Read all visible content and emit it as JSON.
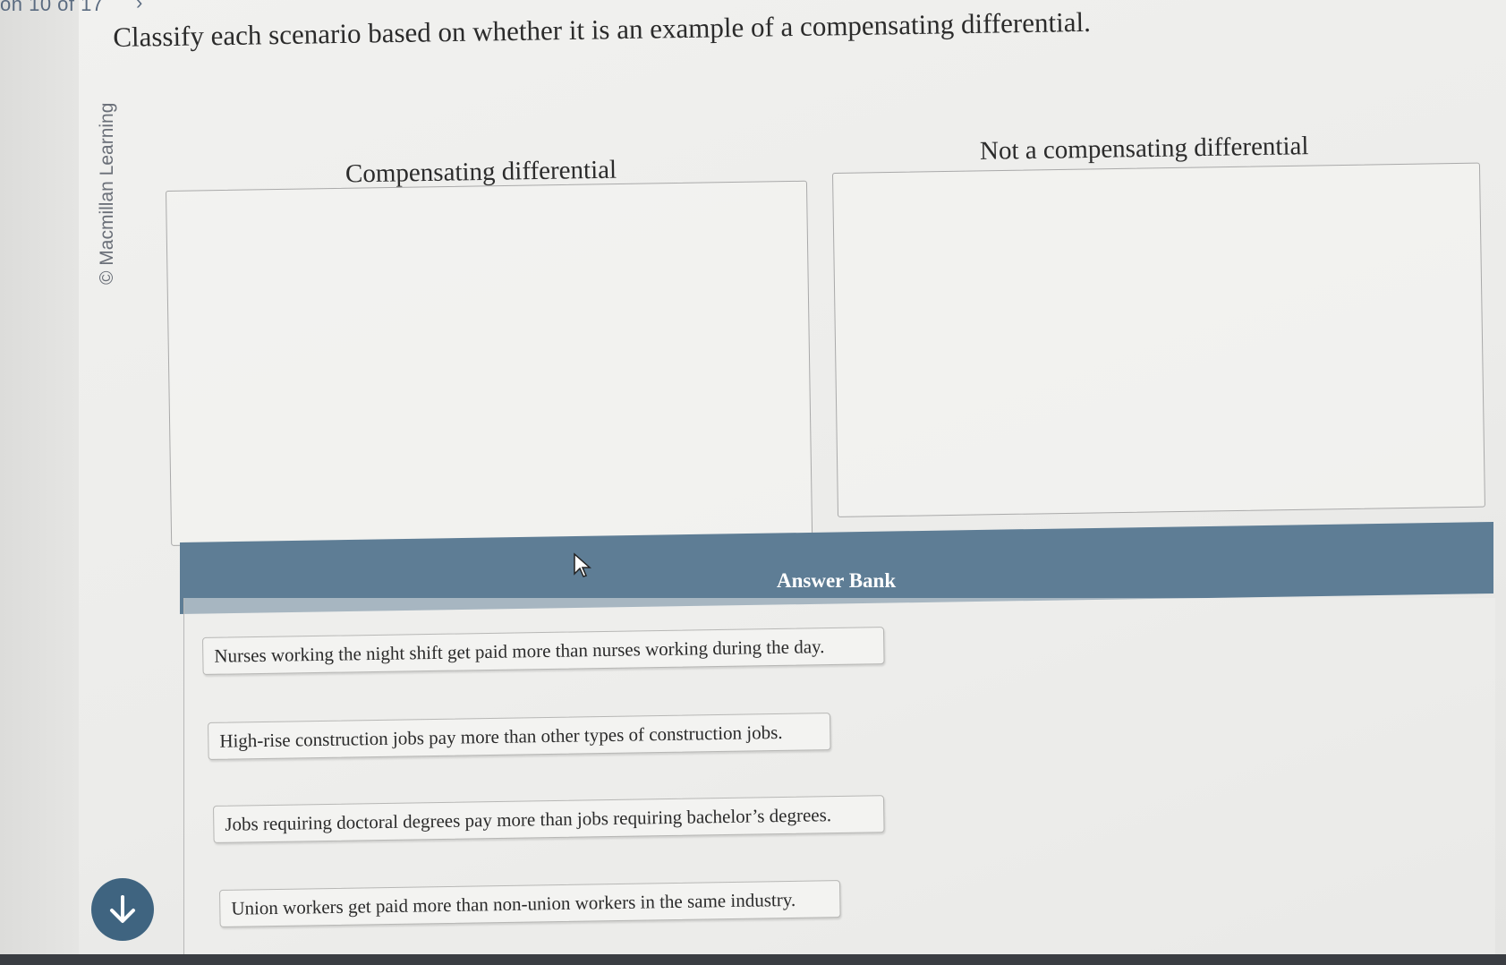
{
  "nav": {
    "question_counter": "on 10 of 17",
    "next_chevron": "›"
  },
  "prompt": "Classify each scenario based on whether it is an example of a compensating differential.",
  "copyright": "© Macmillan Learning",
  "bins": [
    {
      "title": "Compensating differential"
    },
    {
      "title": "Not a compensating differential"
    }
  ],
  "answer_bank": {
    "title": "Answer Bank",
    "items": [
      "Nurses working the night shift get paid more than nurses working during the day.",
      "High-rise construction jobs pay more than other types of construction jobs.",
      "Jobs requiring doctoral degrees pay more than jobs requiring bachelor’s degrees.",
      "Union workers get paid more than non-union workers in the same industry."
    ]
  },
  "icons": {
    "scroll_down": "arrow-down-icon",
    "pointer": "mouse-cursor-icon"
  },
  "colors": {
    "bank_header": "#5e7d95",
    "scroll_button": "#3f6480",
    "nav_text": "#5a6b80"
  }
}
